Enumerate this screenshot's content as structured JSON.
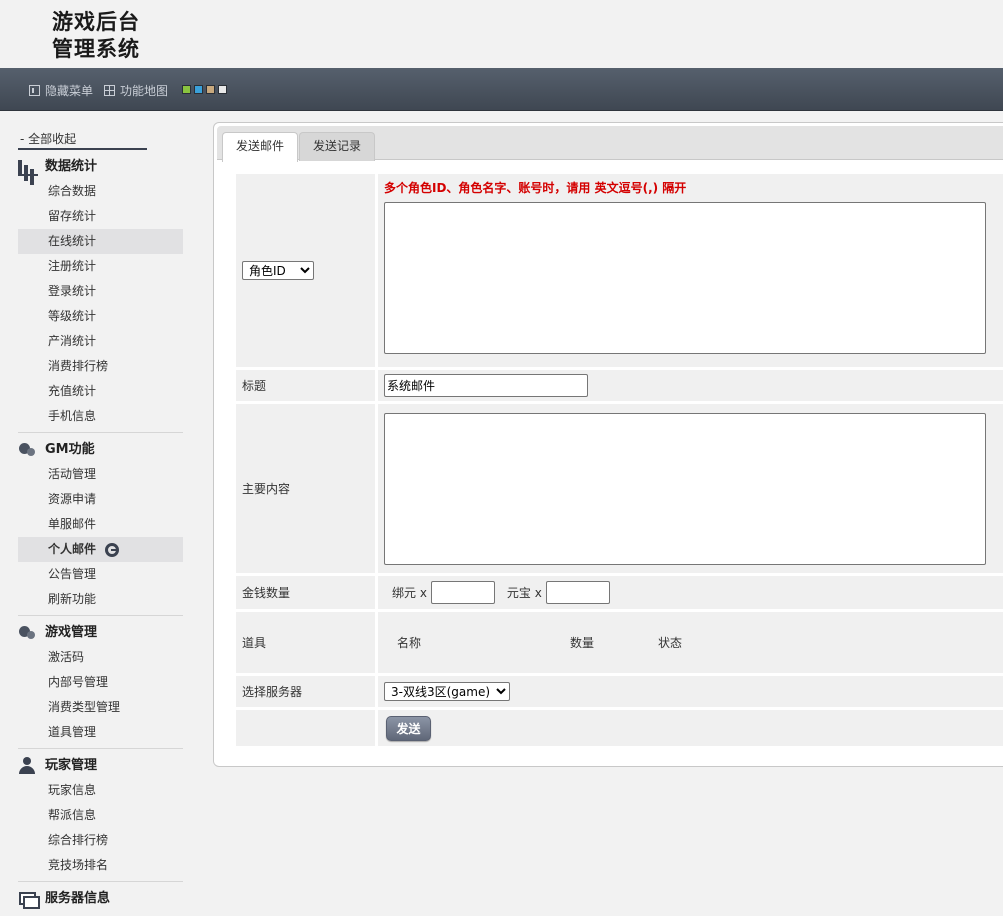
{
  "header": {
    "logo_line1": "游戏后台",
    "logo_line2": "管理系统",
    "hide_menu": "隐藏菜单",
    "func_map": "功能地图",
    "theme_colors": [
      "#8ac43f",
      "#3aa0d9",
      "#c8a97e",
      "#e8e8e8"
    ]
  },
  "sidebar": {
    "collapse_all": "- 全部收起",
    "groups": [
      {
        "title": "数据统计",
        "icon": "bar-chart-icon",
        "items": [
          "综合数据",
          "留存统计",
          "在线统计",
          "注册统计",
          "登录统计",
          "等级统计",
          "产消统计",
          "消费排行榜",
          "充值统计",
          "手机信息"
        ]
      },
      {
        "title": "GM功能",
        "icon": "gm-circles-icon",
        "items": [
          "活动管理",
          "资源申请",
          "单服邮件",
          "个人邮件",
          "公告管理",
          "刷新功能"
        ]
      },
      {
        "title": "游戏管理",
        "icon": "game-circles-icon",
        "items": [
          "激活码",
          "内部号管理",
          "消费类型管理",
          "道具管理"
        ]
      },
      {
        "title": "玩家管理",
        "icon": "user-icon",
        "items": [
          "玩家信息",
          "帮派信息",
          "综合排行榜",
          "竞技场排名"
        ]
      },
      {
        "title": "服务器信息",
        "icon": "server-icon",
        "items": []
      }
    ]
  },
  "tabs": [
    {
      "label": "发送邮件",
      "active": true
    },
    {
      "label": "发送记录",
      "active": false
    }
  ],
  "form": {
    "target_type": {
      "selected": "角色ID"
    },
    "hint": "多个角色ID、角色名字、账号时，请用 英文逗号(,) 隔开",
    "ids_value": "",
    "title_label": "标题",
    "title_value": "系统邮件",
    "content_label": "主要内容",
    "content_value": "",
    "money_label": "金钱数量",
    "bound_yuan_label": "绑元 x",
    "bound_yuan_value": "",
    "yuanbao_label": "元宝 x",
    "yuanbao_value": "",
    "items_label": "道具",
    "items_columns": [
      "名称",
      "数量",
      "状态"
    ],
    "server_label": "选择服务器",
    "server_selected": "3-双线3区(game)",
    "send_label": "发送"
  }
}
